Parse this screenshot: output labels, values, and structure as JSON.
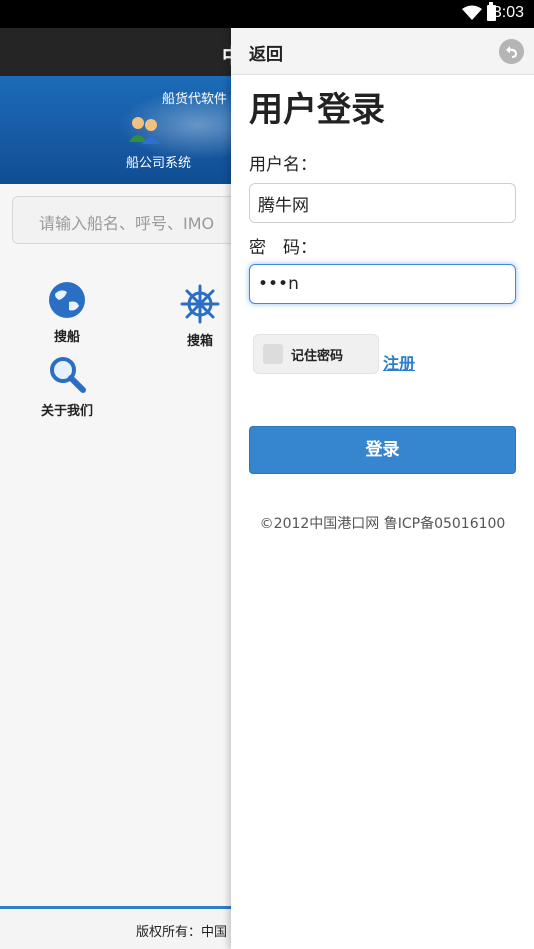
{
  "status_bar": {
    "time": "3:03"
  },
  "background_app": {
    "header_title": "中",
    "banner": {
      "tagline": "船货代软件",
      "system_label": "船公司系统"
    },
    "search": {
      "placeholder": "请输入船名、呼号、IMO"
    },
    "menu": [
      {
        "label": "搜船",
        "icon": "globe-icon"
      },
      {
        "label": "搜箱",
        "icon": "ship-wheel-icon"
      },
      {
        "label": "关于我们",
        "icon": "magnifier-icon"
      }
    ],
    "footer": "版权所有：中国"
  },
  "drawer": {
    "back_label": "返回",
    "title": "用户登录",
    "username_label": "用户名：",
    "username_value": "腾牛网",
    "password_label": "密　码：",
    "password_value": "•••n",
    "remember_label": "记住密码",
    "register_label": "注册",
    "login_button": "登录",
    "copyright": "©2012中国港口网 鲁ICP备05016100"
  },
  "colors": {
    "accent": "#3585cf",
    "banner": "#1659a3",
    "link": "#2c7ec8"
  }
}
